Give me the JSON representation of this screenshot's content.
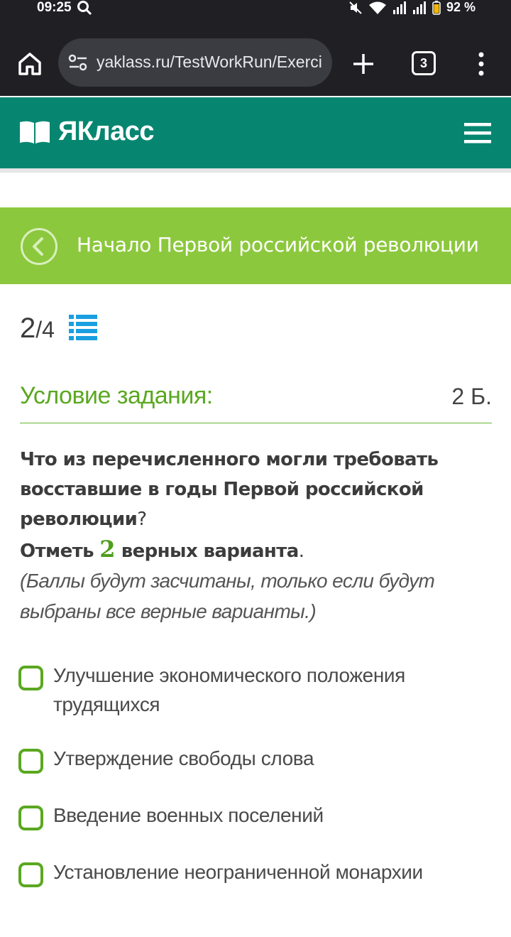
{
  "status_bar": {
    "time": "09:25",
    "battery": "92 %",
    "icons": [
      "search-icon",
      "mute-icon",
      "wifi-icon",
      "signal-icon",
      "signal-icon",
      "battery-icon"
    ]
  },
  "browser": {
    "url": "yaklass.ru/TestWorkRun/Exerci",
    "tab_count": "3",
    "icons": [
      "home-icon",
      "site-settings-icon",
      "plus-icon",
      "more-vert-icon"
    ]
  },
  "site": {
    "logo_text": "ЯКласс",
    "brand_color": "#068670",
    "icons": [
      "book-logo-icon",
      "hamburger-menu-icon"
    ]
  },
  "topic": {
    "title": "Начало Первой российской революции",
    "color": "#8cc83d"
  },
  "progress": {
    "current": "2",
    "separator": "/",
    "total": "4"
  },
  "condition": {
    "title": "Условие задания:",
    "points": "2 Б."
  },
  "question": {
    "text_main": "Что из перечисленного могли требовать восставшие в годы Первой российской революции",
    "qmark": "?",
    "mark_prefix": "Отметь",
    "mark_number": "2",
    "mark_suffix": "верных варианта",
    "period": ".",
    "note": "(Баллы будут засчитаны, только если будут выбраны все верные варианты.)"
  },
  "options": [
    {
      "label": "Улучшение экономического положения трудящихся",
      "checked": false
    },
    {
      "label": "Утверждение свободы слова",
      "checked": false
    },
    {
      "label": "Введение военных поселений",
      "checked": false
    },
    {
      "label": "Установление неограниченной монархии",
      "checked": false
    }
  ]
}
